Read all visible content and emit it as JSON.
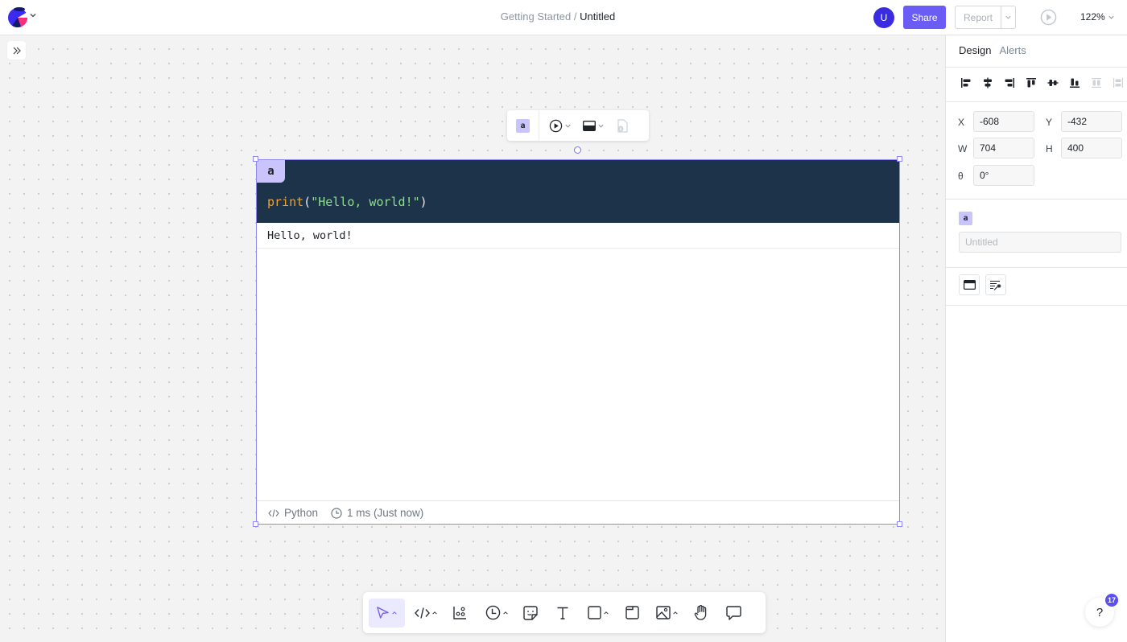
{
  "topbar": {
    "breadcrumb_parent": "Getting Started",
    "breadcrumb_separator": "/",
    "breadcrumb_current": "Untitled",
    "avatar_initial": "U",
    "share_label": "Share",
    "report_label": "Report",
    "zoom_level": "122%"
  },
  "colors": {
    "accent": "#6b5cf5",
    "avatar": "#3b2be0",
    "code_bg": "#1c334a",
    "cell_badge": "#c9c4fb"
  },
  "element_toolbar": {
    "cell_badge": "a"
  },
  "cell": {
    "name_badge": "a",
    "code": {
      "function": "print",
      "open_paren": "(",
      "string": "\"Hello, world!\"",
      "close_paren": ")"
    },
    "output": "Hello, world!",
    "footer": {
      "language": "Python",
      "runtime": "1 ms (Just now)"
    }
  },
  "panel": {
    "tabs": [
      "Design",
      "Alerts"
    ],
    "fields": {
      "x_label": "X",
      "x_value": "-608",
      "y_label": "Y",
      "y_value": "-432",
      "w_label": "W",
      "w_value": "704",
      "h_label": "H",
      "h_value": "400",
      "rotation_label": "θ",
      "rotation_value": "0°"
    },
    "cell_badge": "a",
    "name_placeholder": "Untitled"
  },
  "help": {
    "label": "?",
    "badge_count": "17"
  },
  "bottom_toolbar": {
    "tools": [
      "select-tool",
      "code-tool",
      "chart-tool",
      "schedule-tool",
      "sticky-tool",
      "text-tool",
      "shape-tool",
      "frame-tool",
      "image-tool",
      "pan-tool",
      "comment-tool"
    ]
  }
}
